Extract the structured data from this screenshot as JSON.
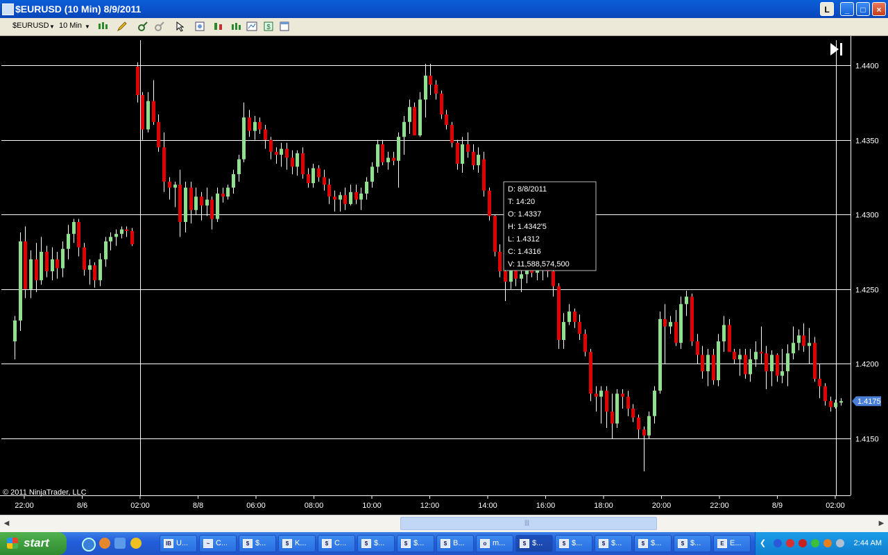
{
  "window": {
    "title": "$EURUSD (10 Min)  8/9/2011",
    "buttons": {
      "L": "L",
      "minimize": "_",
      "maximize": "□",
      "close": "×"
    }
  },
  "toolbar": {
    "instrument": "$EURUSD",
    "interval": "10 Min"
  },
  "chart_data": {
    "type": "candlestick",
    "instrument": "$EURUSD",
    "interval": "10 Min",
    "ylim": [
      1.4108,
      1.4425
    ],
    "y_ticks": [
      "1.4400",
      "1.4350",
      "1.4300",
      "1.4250",
      "1.4200",
      "1.4150"
    ],
    "x_ticks": [
      "22:00",
      "8/6",
      "02:00",
      "8/8",
      "06:00",
      "08:00",
      "10:00",
      "12:00",
      "14:00",
      "16:00",
      "18:00",
      "20:00",
      "22:00",
      "8/9",
      "02:00"
    ],
    "last_price": "1.4175",
    "copyright": "© 2011 NinjaTrader, LLC",
    "crosshair": {
      "time_label": "02:00",
      "price_level": 1.43
    },
    "data_box": {
      "lines": [
        "D: 8/8/2011",
        "T: 14:20",
        "O: 1.4337",
        "H: 1.4342'5",
        "L: 1.4312",
        "C: 1.4316",
        "V: 11,588,574,500"
      ]
    },
    "colors": {
      "up": "#90e090",
      "down": "#e00000",
      "wick": "#ffffff",
      "grid": "#ffffff",
      "background": "#000000",
      "price_marker": "#4a7fd8"
    },
    "candles": [
      [
        1.4215,
        1.4232,
        1.4203,
        1.4229
      ],
      [
        1.4229,
        1.4288,
        1.4222,
        1.4282
      ],
      [
        1.4282,
        1.4292,
        1.4244,
        1.425
      ],
      [
        1.425,
        1.4276,
        1.4244,
        1.427
      ],
      [
        1.427,
        1.4281,
        1.4248,
        1.4256
      ],
      [
        1.4256,
        1.4285,
        1.4253,
        1.4275
      ],
      [
        1.4275,
        1.4279,
        1.4258,
        1.4262
      ],
      [
        1.4262,
        1.4278,
        1.4256,
        1.427
      ],
      [
        1.427,
        1.4275,
        1.4257,
        1.4264
      ],
      [
        1.4264,
        1.4282,
        1.4258,
        1.4277
      ],
      [
        1.4277,
        1.4293,
        1.427,
        1.4287
      ],
      [
        1.4287,
        1.4297,
        1.4281,
        1.4295
      ],
      [
        1.4295,
        1.4297,
        1.4272,
        1.4278
      ],
      [
        1.4278,
        1.4281,
        1.4259,
        1.4263
      ],
      [
        1.4263,
        1.427,
        1.4253,
        1.4266
      ],
      [
        1.4266,
        1.4268,
        1.4251,
        1.4256
      ],
      [
        1.4256,
        1.4274,
        1.4252,
        1.427
      ],
      [
        1.427,
        1.4285,
        1.4265,
        1.4282
      ],
      [
        1.4282,
        1.4288,
        1.4276,
        1.4285
      ],
      [
        1.4285,
        1.429,
        1.4279,
        1.4287
      ],
      [
        1.4287,
        1.4292,
        1.4284,
        1.429
      ],
      [
        1.429,
        1.4292,
        1.4285,
        1.4289
      ],
      [
        1.4289,
        1.4291,
        1.4279,
        1.428
      ],
      [
        1.4399,
        1.4402,
        1.4375,
        1.438
      ],
      [
        1.438,
        1.4382,
        1.435,
        1.4357
      ],
      [
        1.4357,
        1.4382,
        1.4355,
        1.4376
      ],
      [
        1.4376,
        1.439,
        1.436,
        1.4362
      ],
      [
        1.4362,
        1.4367,
        1.4342,
        1.4345
      ],
      [
        1.4345,
        1.4355,
        1.4315,
        1.4322
      ],
      [
        1.4322,
        1.4325,
        1.431,
        1.4318
      ],
      [
        1.4318,
        1.4322,
        1.4305,
        1.432
      ],
      [
        1.432,
        1.433,
        1.4285,
        1.4295
      ],
      [
        1.4295,
        1.4322,
        1.4288,
        1.4318
      ],
      [
        1.4318,
        1.4322,
        1.4294,
        1.4303
      ],
      [
        1.4303,
        1.4318,
        1.43,
        1.4312
      ],
      [
        1.4312,
        1.4315,
        1.4296,
        1.4306
      ],
      [
        1.4306,
        1.4318,
        1.4299,
        1.431
      ],
      [
        1.431,
        1.4312,
        1.429,
        1.4297
      ],
      [
        1.4297,
        1.4318,
        1.4295,
        1.4314
      ],
      [
        1.4314,
        1.4318,
        1.4308,
        1.4312
      ],
      [
        1.4312,
        1.432,
        1.431,
        1.4318
      ],
      [
        1.4318,
        1.433,
        1.4314,
        1.4327
      ],
      [
        1.4327,
        1.434,
        1.4322,
        1.4337
      ],
      [
        1.4337,
        1.4375,
        1.4335,
        1.4365
      ],
      [
        1.4365,
        1.437,
        1.4352,
        1.4356
      ],
      [
        1.4356,
        1.4366,
        1.435,
        1.4362
      ],
      [
        1.4362,
        1.4365,
        1.4354,
        1.4357
      ],
      [
        1.4357,
        1.436,
        1.4344,
        1.435
      ],
      [
        1.435,
        1.4352,
        1.4337,
        1.4342
      ],
      [
        1.4342,
        1.4345,
        1.4334,
        1.434
      ],
      [
        1.434,
        1.4348,
        1.4332,
        1.4344
      ],
      [
        1.4344,
        1.4348,
        1.433,
        1.4338
      ],
      [
        1.4338,
        1.4343,
        1.4327,
        1.4332
      ],
      [
        1.4332,
        1.4343,
        1.4326,
        1.4341
      ],
      [
        1.4341,
        1.4345,
        1.4324,
        1.4327
      ],
      [
        1.4327,
        1.4331,
        1.4318,
        1.4321
      ],
      [
        1.4321,
        1.4334,
        1.4318,
        1.4331
      ],
      [
        1.4331,
        1.4333,
        1.4322,
        1.4325
      ],
      [
        1.4325,
        1.433,
        1.4316,
        1.432
      ],
      [
        1.432,
        1.4324,
        1.4307,
        1.4312
      ],
      [
        1.4312,
        1.4316,
        1.4302,
        1.431
      ],
      [
        1.431,
        1.4315,
        1.4302,
        1.4313
      ],
      [
        1.4313,
        1.4318,
        1.4303,
        1.4307
      ],
      [
        1.4307,
        1.432,
        1.4306,
        1.4315
      ],
      [
        1.4315,
        1.432,
        1.4307,
        1.431
      ],
      [
        1.431,
        1.4318,
        1.4303,
        1.4314
      ],
      [
        1.4314,
        1.4325,
        1.431,
        1.4322
      ],
      [
        1.4322,
        1.4335,
        1.4318,
        1.4332
      ],
      [
        1.4332,
        1.435,
        1.4328,
        1.4347
      ],
      [
        1.4347,
        1.435,
        1.4333,
        1.4335
      ],
      [
        1.4335,
        1.4342,
        1.433,
        1.4338
      ],
      [
        1.4338,
        1.4342,
        1.4333,
        1.4336
      ],
      [
        1.4336,
        1.4355,
        1.4318,
        1.4352
      ],
      [
        1.4352,
        1.4366,
        1.434,
        1.4362
      ],
      [
        1.4362,
        1.4377,
        1.4354,
        1.4372
      ],
      [
        1.4372,
        1.4375,
        1.4358,
        1.4353
      ],
      [
        1.4353,
        1.4382,
        1.4352,
        1.4377
      ],
      [
        1.4377,
        1.4401,
        1.4365,
        1.4393
      ],
      [
        1.4393,
        1.4401,
        1.438,
        1.4387
      ],
      [
        1.4387,
        1.439,
        1.4377,
        1.4381
      ],
      [
        1.4381,
        1.4383,
        1.4364,
        1.4367
      ],
      [
        1.4367,
        1.437,
        1.4357,
        1.436
      ],
      [
        1.436,
        1.4362,
        1.4345,
        1.4348
      ],
      [
        1.4348,
        1.435,
        1.433,
        1.4334
      ],
      [
        1.4334,
        1.4352,
        1.4328,
        1.4347
      ],
      [
        1.4347,
        1.4355,
        1.4338,
        1.4342
      ],
      [
        1.4342,
        1.4347,
        1.433,
        1.4333
      ],
      [
        1.4333,
        1.4345,
        1.4328,
        1.434
      ],
      [
        1.4337,
        1.4342,
        1.4312,
        1.4316
      ],
      [
        1.4316,
        1.4318,
        1.4296,
        1.4299
      ],
      [
        1.4299,
        1.43,
        1.4272,
        1.4275
      ],
      [
        1.4275,
        1.428,
        1.4258,
        1.4262
      ],
      [
        1.4262,
        1.4264,
        1.4242,
        1.4255
      ],
      [
        1.4255,
        1.4272,
        1.425,
        1.4266
      ],
      [
        1.4266,
        1.4269,
        1.4252,
        1.4257
      ],
      [
        1.4257,
        1.4273,
        1.4248,
        1.426
      ],
      [
        1.426,
        1.4268,
        1.4254,
        1.4264
      ],
      [
        1.4264,
        1.4268,
        1.4258,
        1.4261
      ],
      [
        1.4261,
        1.427,
        1.4256,
        1.4266
      ],
      [
        1.4266,
        1.4271,
        1.4256,
        1.4268
      ],
      [
        1.4268,
        1.427,
        1.4258,
        1.4262
      ],
      [
        1.4262,
        1.4268,
        1.4245,
        1.4252
      ],
      [
        1.4252,
        1.4254,
        1.421,
        1.4216
      ],
      [
        1.4216,
        1.4234,
        1.421,
        1.4228
      ],
      [
        1.4228,
        1.424,
        1.4226,
        1.4235
      ],
      [
        1.4235,
        1.4237,
        1.4224,
        1.4228
      ],
      [
        1.4228,
        1.4233,
        1.4216,
        1.422
      ],
      [
        1.422,
        1.4223,
        1.4205,
        1.4208
      ],
      [
        1.4208,
        1.421,
        1.4175,
        1.418
      ],
      [
        1.418,
        1.4185,
        1.4168,
        1.4178
      ],
      [
        1.4178,
        1.4185,
        1.416,
        1.4182
      ],
      [
        1.4182,
        1.4185,
        1.4157,
        1.4168
      ],
      [
        1.4168,
        1.418,
        1.415,
        1.416
      ],
      [
        1.416,
        1.4183,
        1.4157,
        1.418
      ],
      [
        1.418,
        1.4183,
        1.417,
        1.4178
      ],
      [
        1.4178,
        1.4182,
        1.4165,
        1.417
      ],
      [
        1.417,
        1.4173,
        1.4161,
        1.4164
      ],
      [
        1.4164,
        1.4166,
        1.415,
        1.4156
      ],
      [
        1.4156,
        1.4158,
        1.4128,
        1.4152
      ],
      [
        1.4152,
        1.4168,
        1.415,
        1.4165
      ],
      [
        1.4165,
        1.4185,
        1.416,
        1.4182
      ],
      [
        1.4182,
        1.4235,
        1.418,
        1.423
      ],
      [
        1.423,
        1.424,
        1.42,
        1.4225
      ],
      [
        1.4225,
        1.4232,
        1.422,
        1.4228
      ],
      [
        1.4228,
        1.4236,
        1.4212,
        1.4214
      ],
      [
        1.4214,
        1.4245,
        1.421,
        1.424
      ],
      [
        1.424,
        1.4249,
        1.4232,
        1.4245
      ],
      [
        1.4245,
        1.4247,
        1.4212,
        1.4215
      ],
      [
        1.4215,
        1.422,
        1.42,
        1.4206
      ],
      [
        1.4206,
        1.4212,
        1.419,
        1.4195
      ],
      [
        1.4195,
        1.421,
        1.4185,
        1.4206
      ],
      [
        1.4206,
        1.421,
        1.4186,
        1.4189
      ],
      [
        1.4189,
        1.422,
        1.4185,
        1.4215
      ],
      [
        1.4215,
        1.4232,
        1.4208,
        1.4226
      ],
      [
        1.4226,
        1.423,
        1.421,
        1.4208
      ],
      [
        1.4208,
        1.421,
        1.42,
        1.4203
      ],
      [
        1.4203,
        1.421,
        1.4192,
        1.4206
      ],
      [
        1.4206,
        1.421,
        1.419,
        1.4193
      ],
      [
        1.4193,
        1.421,
        1.4188,
        1.4203
      ],
      [
        1.4203,
        1.4215,
        1.4198,
        1.4208
      ],
      [
        1.4208,
        1.4225,
        1.42,
        1.4207
      ],
      [
        1.4207,
        1.4212,
        1.4183,
        1.4195
      ],
      [
        1.4195,
        1.4209,
        1.4185,
        1.4206
      ],
      [
        1.4206,
        1.4207,
        1.4188,
        1.4192
      ],
      [
        1.4192,
        1.421,
        1.4187,
        1.4195
      ],
      [
        1.4195,
        1.4213,
        1.4185,
        1.4207
      ],
      [
        1.4207,
        1.4225,
        1.4203,
        1.4214
      ],
      [
        1.4214,
        1.4223,
        1.4209,
        1.4219
      ],
      [
        1.4219,
        1.4227,
        1.4208,
        1.4212
      ],
      [
        1.4212,
        1.4224,
        1.42,
        1.4214
      ],
      [
        1.4214,
        1.4218,
        1.4188,
        1.419
      ],
      [
        1.419,
        1.42,
        1.4177,
        1.4185
      ],
      [
        1.4185,
        1.4187,
        1.4172,
        1.4175
      ],
      [
        1.4175,
        1.4178,
        1.4168,
        1.4171
      ],
      [
        1.4171,
        1.4176,
        1.417,
        1.4174
      ],
      [
        1.4174,
        1.4177,
        1.4172,
        1.4175
      ]
    ]
  },
  "scrollbar": {
    "left_arrow": "◀",
    "right_arrow": "▶",
    "grip": "|||"
  },
  "taskbar": {
    "start_label": "start",
    "tasks": [
      {
        "icon": "IB",
        "label": "U..."
      },
      {
        "icon": "~",
        "label": "C..."
      },
      {
        "icon": "$",
        "label": "$..."
      },
      {
        "icon": "$",
        "label": "K..."
      },
      {
        "icon": "$",
        "label": "C..."
      },
      {
        "icon": "$",
        "label": "$..."
      },
      {
        "icon": "$",
        "label": "$..."
      },
      {
        "icon": "$",
        "label": "B..."
      },
      {
        "icon": "o",
        "label": "m..."
      },
      {
        "icon": "$",
        "label": "$..."
      },
      {
        "icon": "$",
        "label": "$..."
      },
      {
        "icon": "$",
        "label": "$..."
      },
      {
        "icon": "$",
        "label": "$..."
      },
      {
        "icon": "$",
        "label": "$..."
      },
      {
        "icon": "E",
        "label": "E..."
      }
    ],
    "active_task": 9,
    "clock": "2:44 AM"
  }
}
